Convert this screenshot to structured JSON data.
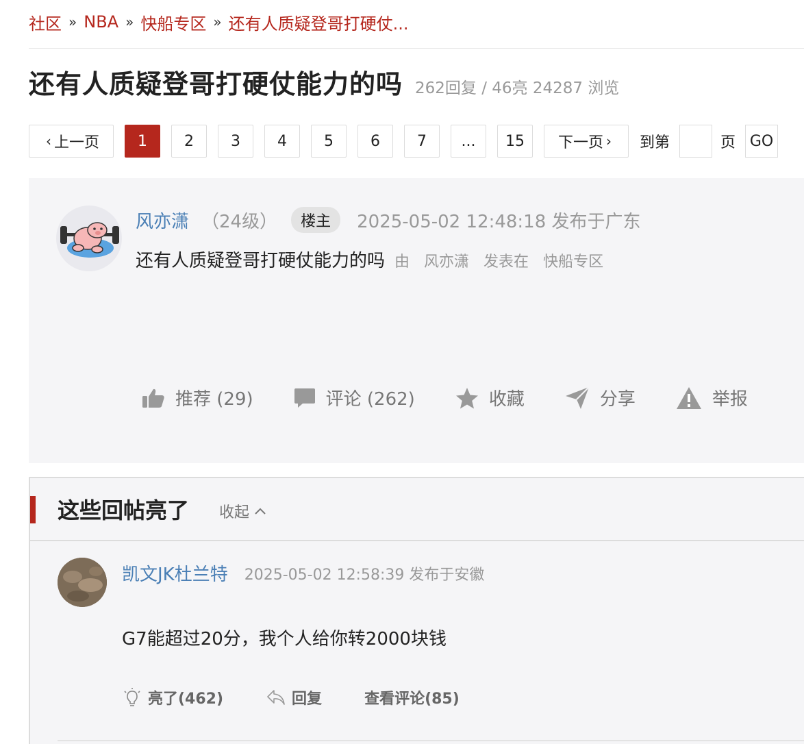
{
  "breadcrumb": {
    "items": [
      "社区",
      "NBA",
      "快船专区",
      "还有人质疑登哥打硬仗..."
    ],
    "separator": "»"
  },
  "thread": {
    "title": "还有人质疑登哥打硬仗能力的吗",
    "stats": "262回复 / 46亮 24287 浏览"
  },
  "pager": {
    "prev": "上一页",
    "pages": [
      "1",
      "2",
      "3",
      "4",
      "5",
      "6",
      "7",
      "...",
      "15"
    ],
    "current": "1",
    "next": "下一页",
    "goto_label": "到第",
    "goto_value": "",
    "page_label": "页",
    "go": "GO"
  },
  "post": {
    "author": "风亦潇",
    "level": "（24级）",
    "owner_badge": "楼主",
    "time": "2025-05-02 12:48:18 发布于广东",
    "content": "还有人质疑登哥打硬仗能力的吗",
    "by": "由",
    "by_author": "风亦潇",
    "posted_in": "发表在",
    "forum": "快船专区",
    "actions": {
      "recommend": "推荐 (29)",
      "comment": "评论 (262)",
      "favorite": "收藏",
      "share": "分享",
      "report": "举报"
    }
  },
  "hot": {
    "title": "这些回帖亮了",
    "collapse": "收起",
    "reply": {
      "author": "凯文JK杜兰特",
      "time": "2025-05-02 12:58:39 发布于安徽",
      "content": "G7能超过20分，我个人给你转2000块钱",
      "light": "亮了(462)",
      "reply": "回复",
      "view_comments": "查看评论(85)"
    }
  },
  "colors": {
    "accent": "#b5271d",
    "link": "#4a7fb5",
    "muted": "#999999",
    "panel": "#f5f5f7"
  }
}
